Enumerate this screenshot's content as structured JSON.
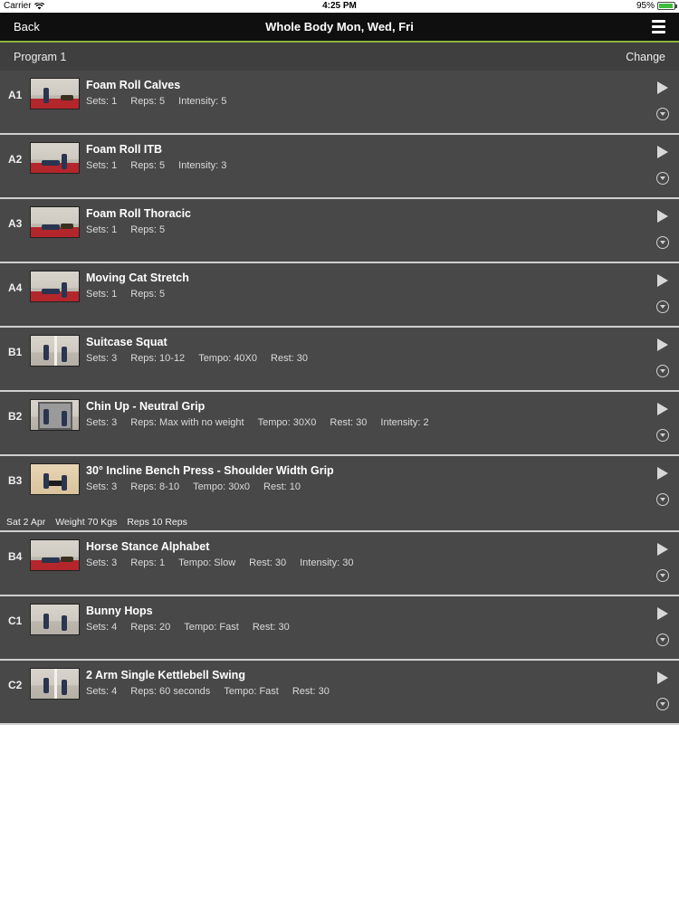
{
  "status_bar": {
    "carrier": "Carrier",
    "time": "4:25 PM",
    "battery": "95%",
    "battery_level": 0.95
  },
  "nav": {
    "back": "Back",
    "title": "Whole Body Mon, Wed, Fri",
    "menu_icon": "hamburger-menu-icon"
  },
  "program": {
    "name": "Program 1",
    "change": "Change"
  },
  "exercises": [
    {
      "code": "A1",
      "title": "Foam Roll Calves",
      "stats": [
        "Sets: 1",
        "Reps: 5",
        "Intensity: 5"
      ]
    },
    {
      "code": "A2",
      "title": "Foam Roll ITB",
      "stats": [
        "Sets: 1",
        "Reps: 5",
        "Intensity: 3"
      ]
    },
    {
      "code": "A3",
      "title": "Foam Roll Thoracic",
      "stats": [
        "Sets: 1",
        "Reps: 5"
      ]
    },
    {
      "code": "A4",
      "title": "Moving Cat Stretch",
      "stats": [
        "Sets: 1",
        "Reps: 5"
      ]
    },
    {
      "code": "B1",
      "title": "Suitcase Squat",
      "stats": [
        "Sets: 3",
        "Reps: 10-12",
        "Tempo: 40X0",
        "Rest: 30"
      ]
    },
    {
      "code": "B2",
      "title": "Chin Up - Neutral Grip",
      "stats": [
        "Sets: 3",
        "Reps: Max with no weight",
        "Tempo: 30X0",
        "Rest: 30",
        "Intensity: 2"
      ]
    },
    {
      "code": "B3",
      "title": "30° Incline Bench Press - Shoulder Width Grip",
      "stats": [
        "Sets: 3",
        "Reps: 8-10",
        "Tempo: 30x0",
        "Rest: 10"
      ],
      "history": [
        "Sat 2 Apr",
        "Weight 70 Kgs",
        "Reps 10 Reps"
      ]
    },
    {
      "code": "B4",
      "title": "Horse Stance Alphabet",
      "stats": [
        "Sets: 3",
        "Reps: 1",
        "Tempo: Slow",
        "Rest: 30",
        "Intensity: 30"
      ]
    },
    {
      "code": "C1",
      "title": "Bunny Hops",
      "stats": [
        "Sets: 4",
        "Reps: 20",
        "Tempo: Fast",
        "Rest: 30"
      ]
    },
    {
      "code": "C2",
      "title": "2 Arm Single Kettlebell Swing",
      "stats": [
        "Sets: 4",
        "Reps: 60 seconds",
        "Tempo: Fast",
        "Rest: 30"
      ]
    }
  ],
  "colors": {
    "accent": "#8ab53f",
    "row_bg": "#484848",
    "nav_bg": "#0f0f0f",
    "separator": "#cfcfcf"
  }
}
